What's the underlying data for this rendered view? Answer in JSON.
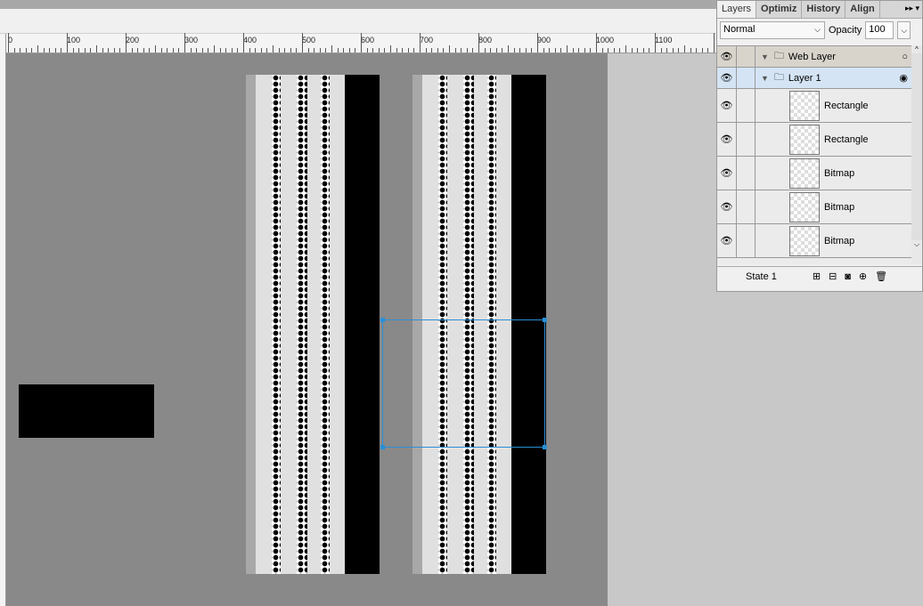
{
  "ruler": {
    "labels": [
      "0",
      "100",
      "200",
      "300",
      "400",
      "500",
      "600",
      "700",
      "800",
      "900",
      "1000",
      "1100"
    ]
  },
  "panel": {
    "tabs": [
      "Layers",
      "Optimiz",
      "History",
      "Align"
    ],
    "blend_mode": "Normal",
    "opacity_label": "Opacity",
    "opacity_value": "100",
    "layers": [
      {
        "name": "Web Layer",
        "type": "folder"
      },
      {
        "name": "Layer 1",
        "type": "folder",
        "selected": true
      },
      {
        "name": "Rectangle",
        "type": "rectangle"
      },
      {
        "name": "Rectangle",
        "type": "rectangle"
      },
      {
        "name": "Bitmap",
        "type": "bitmap"
      },
      {
        "name": "Bitmap",
        "type": "bitmap"
      },
      {
        "name": "Bitmap",
        "type": "bitmap"
      }
    ],
    "state": "State 1"
  },
  "colors": {
    "canvas": "#898989",
    "selection": "#2a8fd6",
    "layer_selected": "#d4e4f4"
  }
}
